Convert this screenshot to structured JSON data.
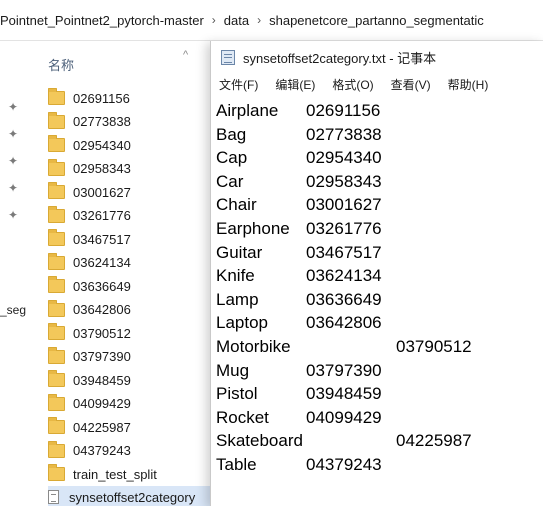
{
  "explorer": {
    "breadcrumb": [
      "Pointnet_Pointnet2_pytorch-master",
      "data",
      "shapenetcore_partanno_segmentatic"
    ],
    "nav_partial_label": "_seg",
    "column_header": "名称",
    "folders": [
      "02691156",
      "02773838",
      "02954340",
      "02958343",
      "03001627",
      "03261776",
      "03467517",
      "03624134",
      "03636649",
      "03642806",
      "03790512",
      "03797390",
      "03948459",
      "04099429",
      "04225987",
      "04379243",
      "train_test_split"
    ],
    "selected_file": "synsetoffset2category"
  },
  "notepad": {
    "title": "synsetoffset2category.txt - 记事本",
    "menu": [
      "文件(F)",
      "编辑(E)",
      "格式(O)",
      "查看(V)",
      "帮助(H)"
    ],
    "lines": [
      {
        "name": "Airplane",
        "code": "02691156"
      },
      {
        "name": "Bag",
        "code": "02773838"
      },
      {
        "name": "Cap",
        "code": "02954340"
      },
      {
        "name": "Car",
        "code": "02958343"
      },
      {
        "name": "Chair",
        "code": "03001627"
      },
      {
        "name": "Earphone",
        "code": "03261776"
      },
      {
        "name": "Guitar",
        "code": "03467517"
      },
      {
        "name": "Knife",
        "code": "03624134"
      },
      {
        "name": "Lamp",
        "code": "03636649"
      },
      {
        "name": "Laptop",
        "code": "03642806"
      },
      {
        "name": "Motorbike",
        "code": "03790512"
      },
      {
        "name": "Mug",
        "code": "03797390"
      },
      {
        "name": "Pistol",
        "code": "03948459"
      },
      {
        "name": "Rocket",
        "code": "04099429"
      },
      {
        "name": "Skateboard",
        "code": "04225987"
      },
      {
        "name": "Table",
        "code": "04379243"
      }
    ]
  }
}
